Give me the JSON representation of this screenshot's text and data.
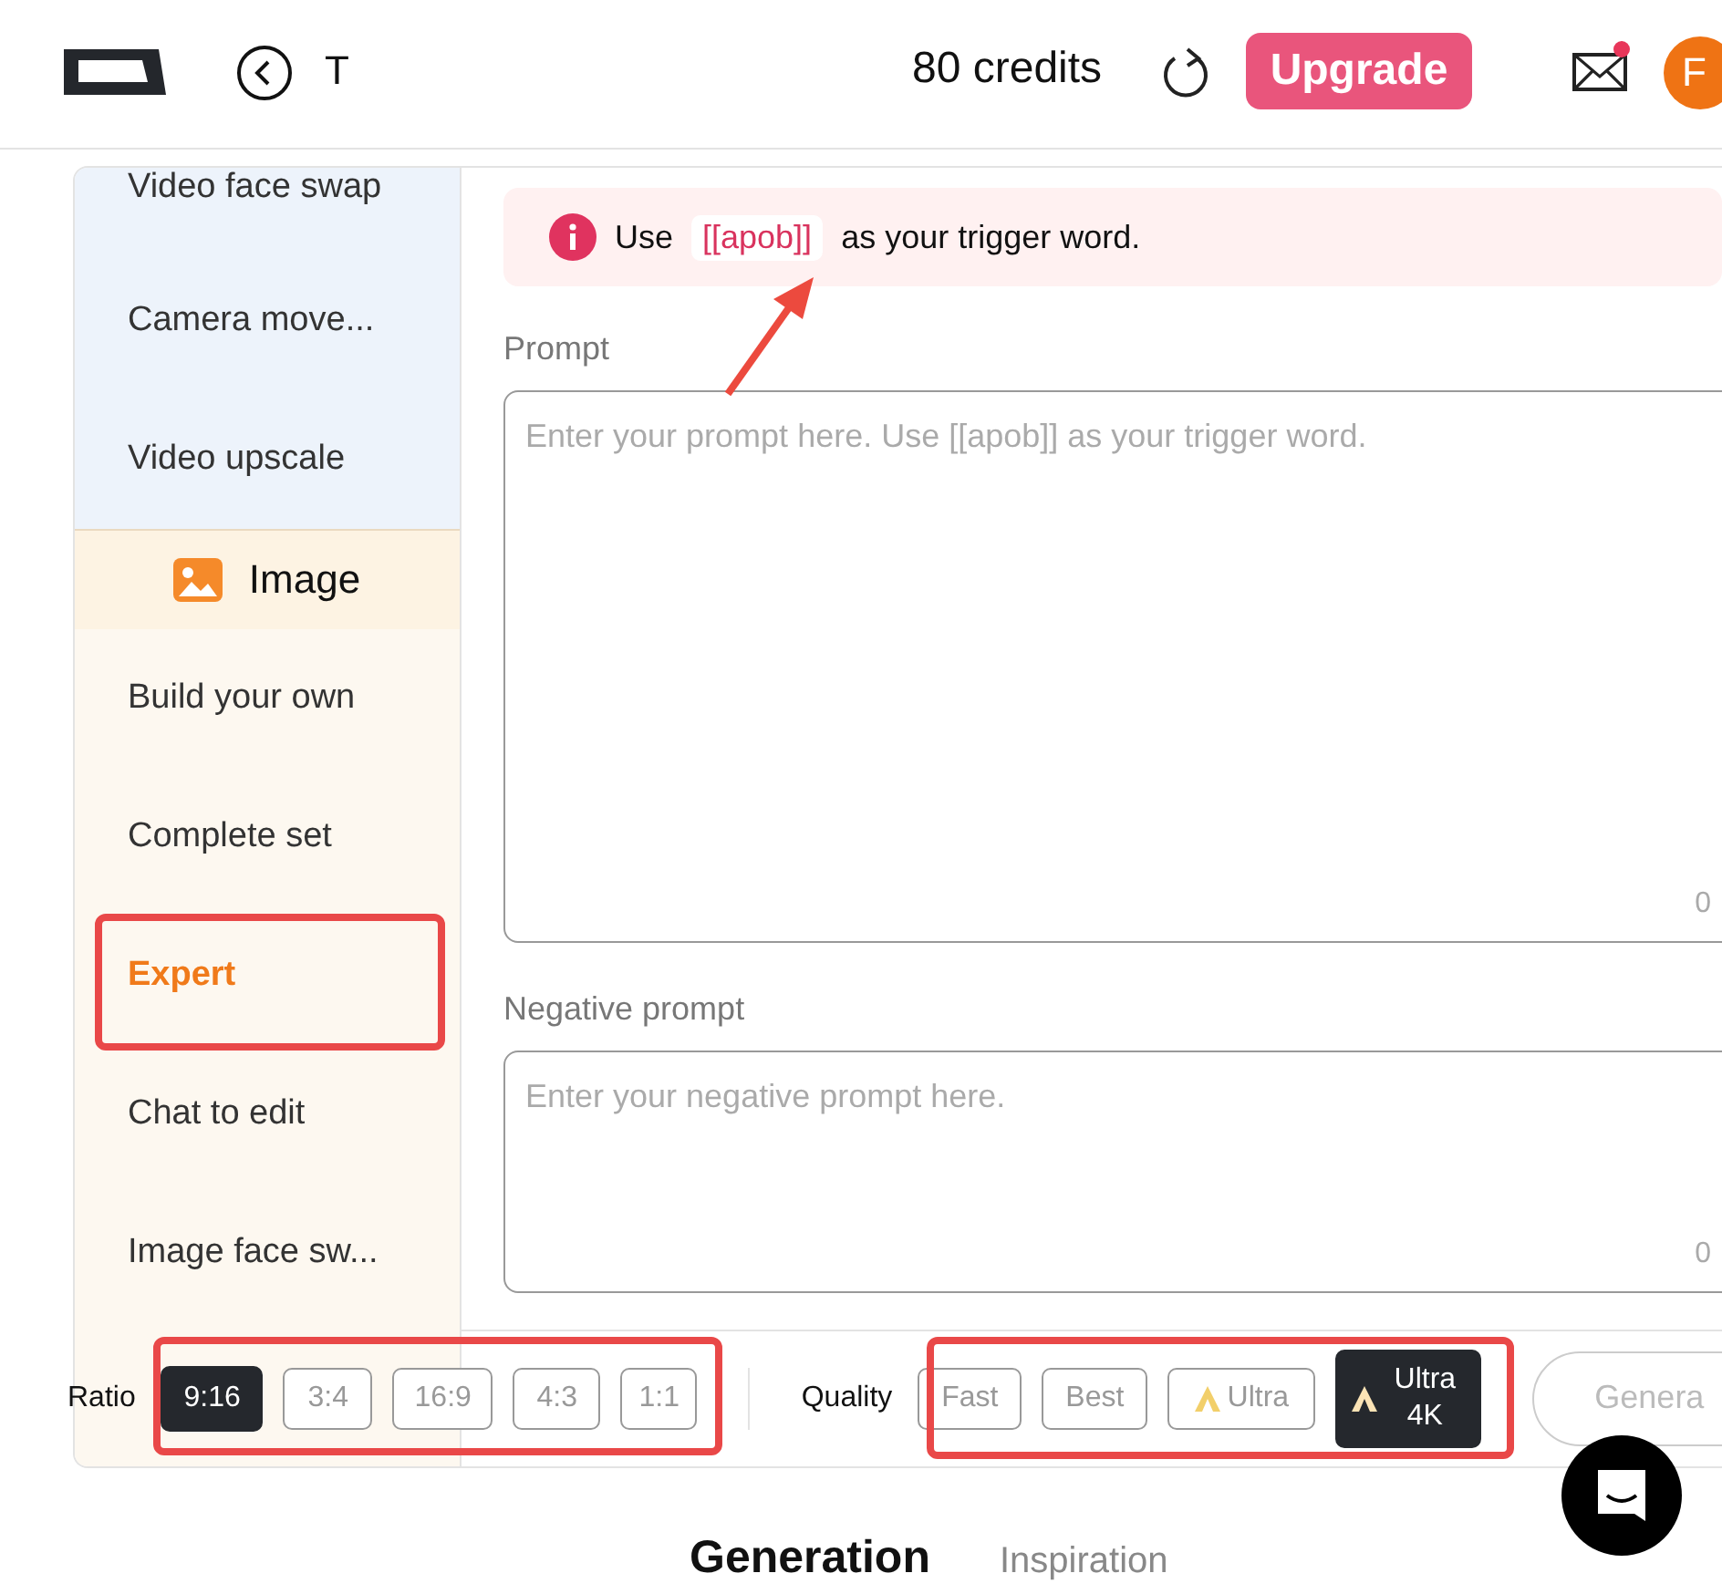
{
  "header": {
    "back_label": "T",
    "credits": "80 credits",
    "upgrade": "Upgrade",
    "mail_unread": true,
    "avatar": "F"
  },
  "sidebar": {
    "sections": [
      {
        "kind": "video",
        "items": [
          {
            "label": "Video face swap",
            "selected": false
          },
          {
            "label": "Camera move...",
            "selected": false
          },
          {
            "label": "Video upscale",
            "selected": false
          }
        ]
      },
      {
        "kind": "image",
        "title": "Image",
        "items": [
          {
            "label": "Build your own",
            "selected": false
          },
          {
            "label": "Complete set",
            "selected": false
          },
          {
            "label": "Expert",
            "selected": true
          },
          {
            "label": "Chat to edit",
            "selected": false
          },
          {
            "label": "Image face sw...",
            "selected": false
          }
        ]
      }
    ]
  },
  "alert": {
    "before": "Use",
    "code": "[[apob]]",
    "after": "as your trigger word."
  },
  "prompt": {
    "label": "Prompt",
    "placeholder": "Enter your prompt here. Use [[apob]] as your trigger word.",
    "counter": "0"
  },
  "negative_prompt": {
    "label": "Negative prompt",
    "placeholder": "Enter your negative prompt here.",
    "counter": "0"
  },
  "ratio": {
    "label": "Ratio",
    "options": [
      {
        "label": "9:16",
        "selected": true
      },
      {
        "label": "3:4",
        "selected": false
      },
      {
        "label": "16:9",
        "selected": false
      },
      {
        "label": "4:3",
        "selected": false
      },
      {
        "label": "1:1",
        "selected": false
      }
    ]
  },
  "quality": {
    "label": "Quality",
    "options": [
      {
        "label": "Fast",
        "selected": false,
        "premium": false
      },
      {
        "label": "Best",
        "selected": false,
        "premium": false
      },
      {
        "label": "Ultra",
        "selected": false,
        "premium": true
      },
      {
        "label": "Ultra 4K",
        "selected": true,
        "premium": true
      }
    ]
  },
  "generate_button": "Genera",
  "tabs": [
    {
      "label": "Generation",
      "selected": true
    },
    {
      "label": "Inspiration",
      "selected": false
    }
  ]
}
